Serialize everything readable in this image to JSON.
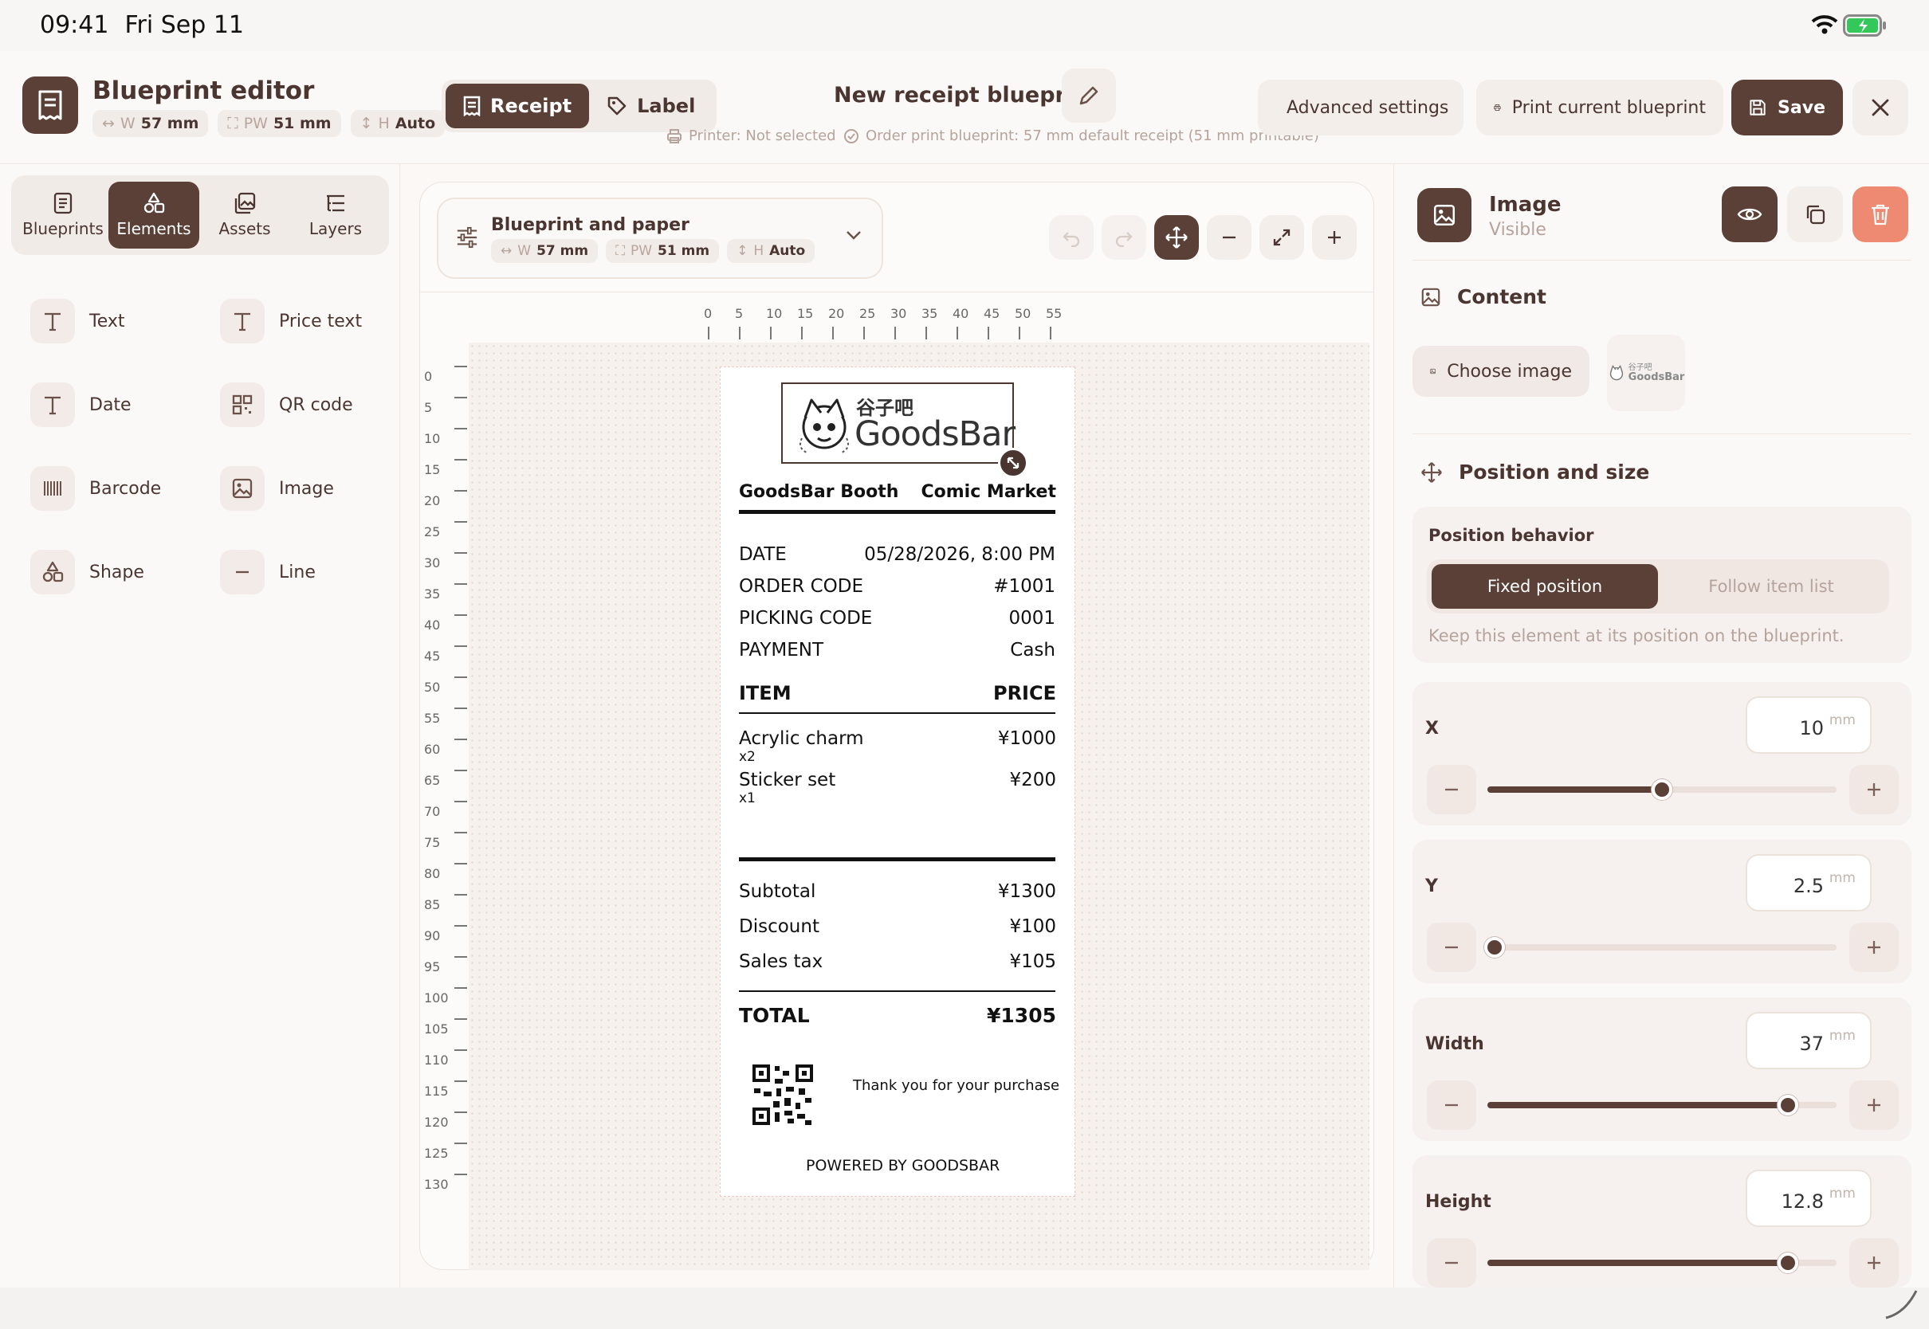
{
  "status": {
    "time": "09:41",
    "date": "Fri Sep 11"
  },
  "header": {
    "title": "Blueprint editor",
    "width_key": "W",
    "width_val": "57 mm",
    "pw_key": "PW",
    "pw_val": "51 mm",
    "h_key": "H",
    "h_val": "Auto",
    "mode_receipt": "Receipt",
    "mode_label": "Label",
    "blueprint_name": "New receipt blueprint",
    "printer_status": "Printer: Not selected",
    "order_print": "Order print blueprint: 57 mm default receipt (51 mm printable)",
    "advanced": "Advanced settings",
    "print": "Print current blueprint",
    "save": "Save"
  },
  "left": {
    "tabs": [
      "Blueprints",
      "Elements",
      "Assets",
      "Layers"
    ],
    "active_tab": "Elements",
    "elements": [
      "Text",
      "Price text",
      "Date",
      "QR code",
      "Barcode",
      "Image",
      "Shape",
      "Line"
    ]
  },
  "canvas": {
    "paper_title": "Blueprint and paper",
    "w_key": "W",
    "w_val": "57 mm",
    "pw_key": "PW",
    "pw_val": "51 mm",
    "h_key": "H",
    "h_val": "Auto",
    "ruler_top": [
      "0",
      "5",
      "10",
      "15",
      "20",
      "25",
      "30",
      "35",
      "40",
      "45",
      "50",
      "55"
    ],
    "ruler_left": [
      "0",
      "5",
      "10",
      "15",
      "20",
      "25",
      "30",
      "35",
      "40",
      "45",
      "50",
      "55",
      "60",
      "65",
      "70",
      "75",
      "80",
      "85",
      "90",
      "95",
      "100",
      "105",
      "110",
      "115",
      "120",
      "125",
      "130"
    ]
  },
  "receipt": {
    "logo_cjk": "谷子吧",
    "logo_text": "GoodsBar",
    "store": "GoodsBar Booth",
    "event": "Comic Market",
    "meta": [
      {
        "k": "DATE",
        "v": "05/28/2026, 8:00 PM"
      },
      {
        "k": "ORDER CODE",
        "v": "#1001"
      },
      {
        "k": "PICKING CODE",
        "v": "0001"
      },
      {
        "k": "PAYMENT",
        "v": "Cash"
      }
    ],
    "item_hdr": "ITEM",
    "price_hdr": "PRICE",
    "items": [
      {
        "name": "Acrylic charm",
        "qty": "x2",
        "price": "¥1000"
      },
      {
        "name": "Sticker set",
        "qty": "x1",
        "price": "¥200"
      }
    ],
    "totals": [
      {
        "k": "Subtotal",
        "v": "¥1300"
      },
      {
        "k": "Discount",
        "v": "¥100"
      },
      {
        "k": "Sales tax",
        "v": "¥105"
      }
    ],
    "total_k": "TOTAL",
    "total_v": "¥1305",
    "thanks": "Thank you for your purchase",
    "powered": "POWERED BY GOODSBAR"
  },
  "inspector": {
    "title": "Image",
    "subtitle": "Visible",
    "content": "Content",
    "choose_image": "Choose image",
    "thumb_cjk": "谷子吧",
    "thumb_text": "GoodsBar",
    "pos_size": "Position and size",
    "pos_behavior": "Position behavior",
    "fixed": "Fixed position",
    "follow": "Follow item list",
    "hint": "Keep this element at its position on the blueprint.",
    "fields": [
      {
        "label": "X",
        "value": "10",
        "unit": "mm",
        "fraction": 0.5
      },
      {
        "label": "Y",
        "value": "2.5",
        "unit": "mm",
        "fraction": 0.02
      },
      {
        "label": "Width",
        "value": "37",
        "unit": "mm",
        "fraction": 0.86
      },
      {
        "label": "Height",
        "value": "12.8",
        "unit": "mm",
        "fraction": 0.86
      }
    ]
  },
  "colors": {
    "accent": "#5a4037",
    "danger": "#ef8a72",
    "paper_border": "#f1c9bf"
  }
}
